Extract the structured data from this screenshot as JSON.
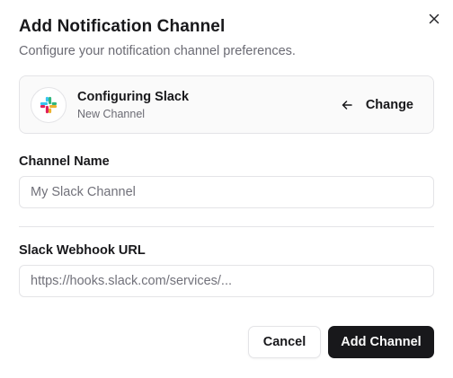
{
  "dialog": {
    "title": "Add Notification Channel",
    "subtitle": "Configure your notification channel preferences."
  },
  "provider": {
    "name": "Configuring Slack",
    "status": "New Channel",
    "change_label": "Change",
    "icon": "slack-logo-icon"
  },
  "fields": {
    "channel_name": {
      "label": "Channel Name",
      "value": "",
      "placeholder": "My Slack Channel"
    },
    "webhook_url": {
      "label": "Slack Webhook URL",
      "value": "",
      "placeholder": "https://hooks.slack.com/services/..."
    }
  },
  "actions": {
    "cancel_label": "Cancel",
    "submit_label": "Add Channel"
  },
  "colors": {
    "primary": "#18181b",
    "border": "#e4e4e7",
    "muted_text": "#6b6b74",
    "slack_blue": "#36C5F0",
    "slack_green": "#2EB67D",
    "slack_yellow": "#ECB22E",
    "slack_red": "#E01E5A"
  }
}
